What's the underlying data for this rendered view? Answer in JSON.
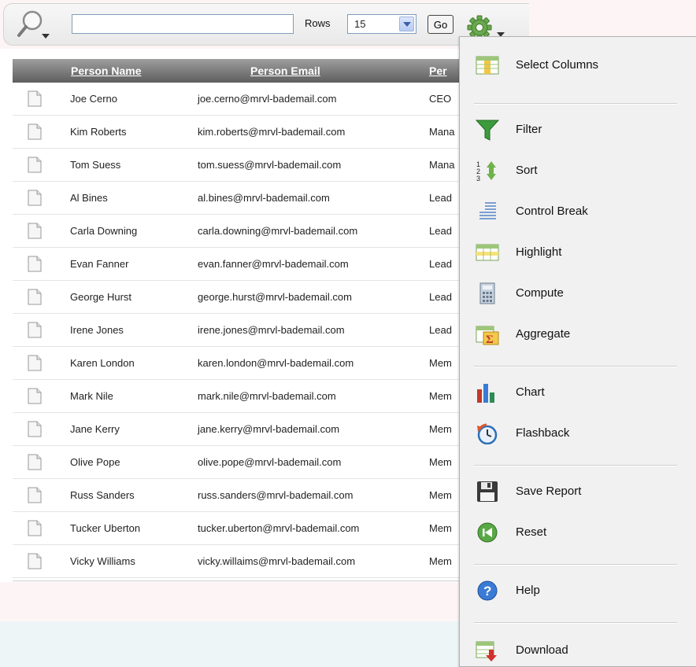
{
  "toolbar": {
    "search_value": "",
    "rows_label": "Rows",
    "rows_value": "15",
    "go_label": "Go"
  },
  "table": {
    "columns": [
      "Person Name",
      "Person Email",
      "Per"
    ],
    "rows": [
      {
        "name": "Joe Cerno",
        "email": "joe.cerno@mrvl-bademail.com",
        "role": "CEO"
      },
      {
        "name": "Kim Roberts",
        "email": "kim.roberts@mrvl-bademail.com",
        "role": "Mana"
      },
      {
        "name": "Tom Suess",
        "email": "tom.suess@mrvl-bademail.com",
        "role": "Mana"
      },
      {
        "name": "Al Bines",
        "email": "al.bines@mrvl-bademail.com",
        "role": "Lead"
      },
      {
        "name": "Carla Downing",
        "email": "carla.downing@mrvl-bademail.com",
        "role": "Lead"
      },
      {
        "name": "Evan Fanner",
        "email": "evan.fanner@mrvl-bademail.com",
        "role": "Lead"
      },
      {
        "name": "George Hurst",
        "email": "george.hurst@mrvl-bademail.com",
        "role": "Lead"
      },
      {
        "name": "Irene Jones",
        "email": "irene.jones@mrvl-bademail.com",
        "role": "Lead"
      },
      {
        "name": "Karen London",
        "email": "karen.london@mrvl-bademail.com",
        "role": "Mem"
      },
      {
        "name": "Mark Nile",
        "email": "mark.nile@mrvl-bademail.com",
        "role": "Mem"
      },
      {
        "name": "Jane Kerry",
        "email": "jane.kerry@mrvl-bademail.com",
        "role": "Mem"
      },
      {
        "name": "Olive Pope",
        "email": "olive.pope@mrvl-bademail.com",
        "role": "Mem"
      },
      {
        "name": "Russ Sanders",
        "email": "russ.sanders@mrvl-bademail.com",
        "role": "Mem"
      },
      {
        "name": "Tucker Uberton",
        "email": "tucker.uberton@mrvl-bademail.com",
        "role": "Mem"
      },
      {
        "name": "Vicky Williams",
        "email": "vicky.willaims@mrvl-bademail.com",
        "role": "Mem"
      }
    ]
  },
  "actions_menu": {
    "select_columns": "Select Columns",
    "filter": "Filter",
    "sort": "Sort",
    "control_break": "Control Break",
    "highlight": "Highlight",
    "compute": "Compute",
    "aggregate": "Aggregate",
    "chart": "Chart",
    "flashback": "Flashback",
    "save_report": "Save Report",
    "reset": "Reset",
    "help": "Help",
    "download": "Download"
  }
}
